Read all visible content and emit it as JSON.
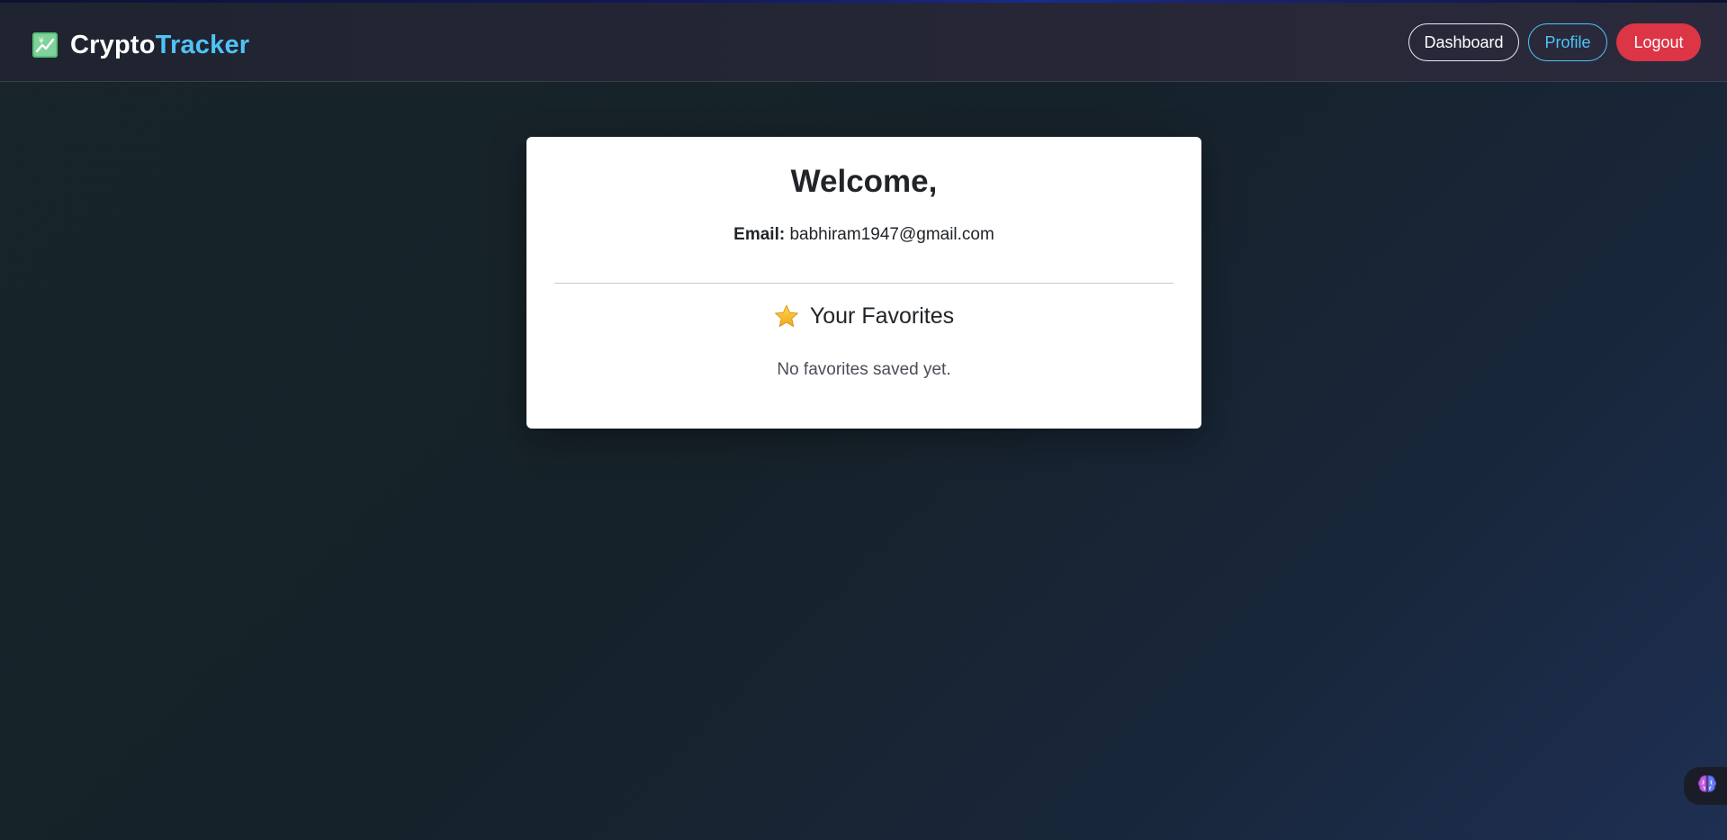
{
  "brand": {
    "first": "Crypto",
    "second": "Tracker",
    "icon": "chart-increasing-icon"
  },
  "nav": {
    "dashboard_label": "Dashboard",
    "profile_label": "Profile",
    "logout_label": "Logout"
  },
  "profile": {
    "welcome": "Welcome,",
    "email_label": "Email:",
    "email_value": "babhiram1947@gmail.com"
  },
  "favorites": {
    "icon": "star-icon",
    "title": "Your Favorites",
    "empty_message": "No favorites saved yet."
  },
  "assistant": {
    "icon": "brain-icon"
  },
  "colors": {
    "accent": "#4fc3f7",
    "logout": "#dc3545",
    "navbar": "#262636",
    "card": "#ffffff"
  }
}
